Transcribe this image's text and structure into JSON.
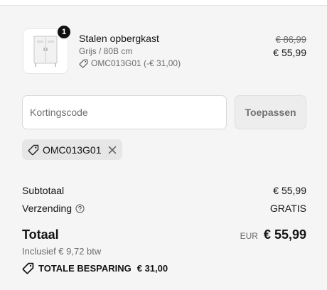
{
  "product": {
    "name": "Stalen opbergkast",
    "variant": "Grijs / 80B cm",
    "discount_line": "OMC013G01 (-€ 31,00)",
    "quantity": "1",
    "price_original": "€ 86,99",
    "price_final": "€ 55,99"
  },
  "discount_code": {
    "placeholder": "Kortingscode",
    "value": "",
    "apply_label": "Toepassen",
    "applied_code": "OMC013G01"
  },
  "summary": {
    "subtotal_label": "Subtotaal",
    "subtotal_value": "€ 55,99",
    "shipping_label": "Verzending",
    "shipping_value": "GRATIS",
    "total_label": "Totaal",
    "currency": "EUR",
    "total_value": "€ 55,99",
    "tax_note": "Inclusief € 9,72 btw",
    "savings_label": "TOTALE BESPARING",
    "savings_value": "€ 31,00"
  },
  "icons": {
    "tag": "tag-icon",
    "close": "close-icon",
    "help": "help-circle-icon",
    "product_image": "cabinet-image"
  }
}
